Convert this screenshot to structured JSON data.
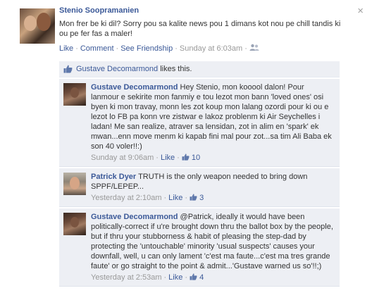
{
  "post": {
    "author": "Stenio Soopramanien",
    "text": "Mon frer be ki dil? Sorry pou sa kalite news pou 1 dimans kot nou pe chill tandis ki ou pe fer fas a maler!",
    "actions": {
      "like": "Like",
      "comment": "Comment",
      "see_friendship": "See Friendship",
      "timestamp": "Sunday at 6:03am",
      "audience_icon": "friends-icon"
    },
    "close_icon": "close-icon",
    "close_glyph": "×"
  },
  "likes": {
    "icon": "thumbs-up-icon",
    "name": "Gustave Decomarmond",
    "suffix": " likes this."
  },
  "comments": [
    {
      "author": "Gustave Decomarmond",
      "text": "Hey Stenio, mon kooool dalon! Pour lanmour e sekirite mon fanmiy e tou lezot mon bann 'loved ones' osi byen ki mon travay, monn les zot koup mon lalang ozordi pour ki ou e lezot lo FB pa konn vre zistwar e lakoz problenm ki Air Seychelles i ladan! Me san realize, atraver sa lensidan, zot in alim en 'spark' ek mwan...enn move menm ki kapab fini mal pour zot...sa tim Ali Baba ek son 40 voler!!:)",
      "timestamp": "Sunday at 9:06am",
      "like": "Like",
      "like_count": "10"
    },
    {
      "author": "Patrick Dyer",
      "text": "TRUTH is the only weapon needed to bring down SPPF/LEPEP...",
      "timestamp": "Yesterday at 2:10am",
      "like": "Like",
      "like_count": "3"
    },
    {
      "author": "Gustave Decomarmond",
      "text": "@Patrick, ideally it would have been politically-correct if u're brought down thru the ballot box by the people, but if thru your stubborness & habit of pleasing the step-dad by protecting the 'untouchable' minority 'usual suspects' causes your downfall, well, u can only lament 'c'est ma faute...c'est ma tres grande faute' or go straight to the point & admit...'Gustave warned us so'!!;)",
      "timestamp": "Yesterday at 2:53am",
      "like": "Like",
      "like_count": "4"
    }
  ],
  "colors": {
    "link": "#3b5998",
    "ufi_background": "#edeff4",
    "meta": "#999999"
  }
}
